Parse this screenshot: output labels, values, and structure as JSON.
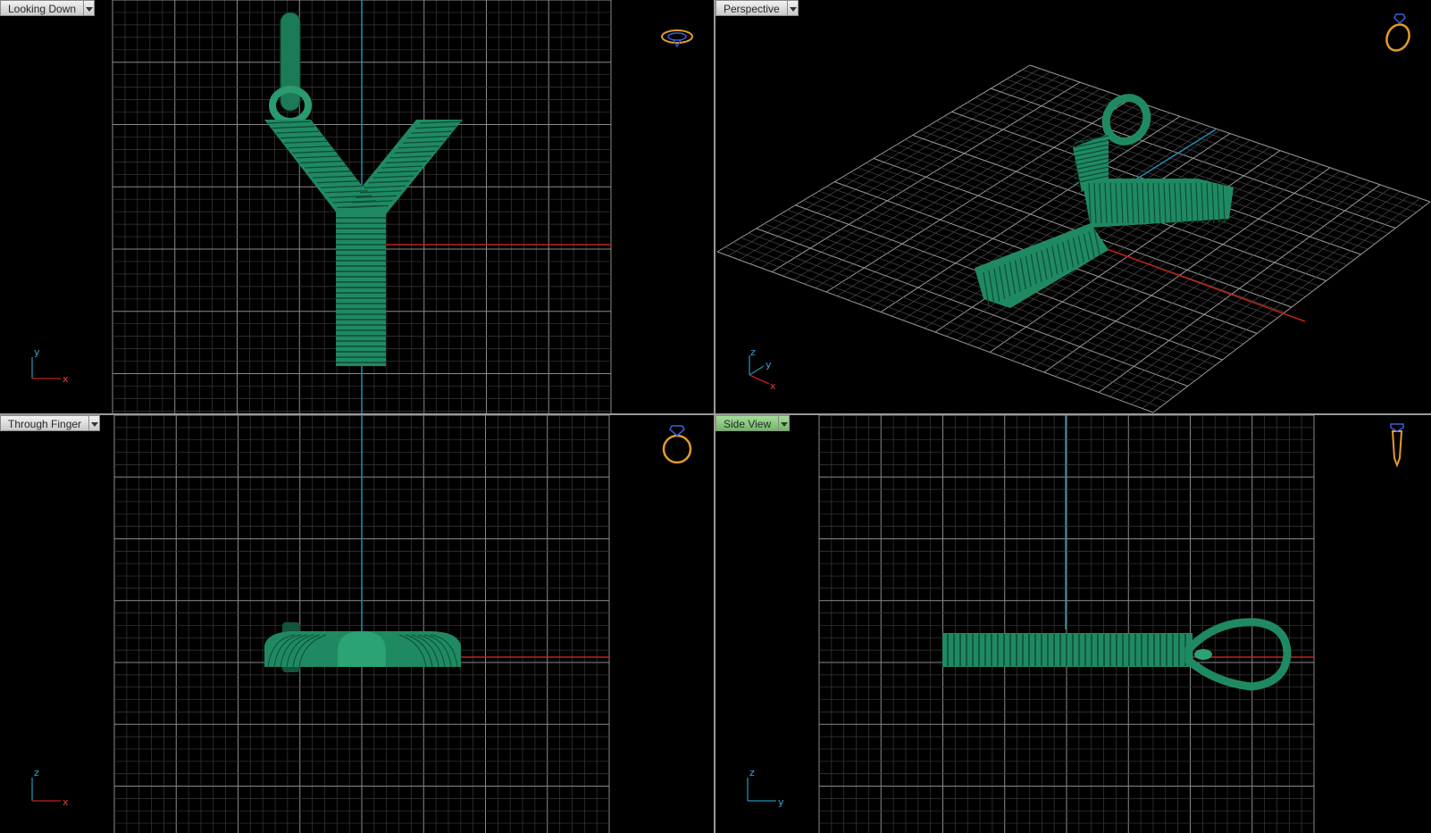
{
  "viewports": {
    "top_left": {
      "label": "Looking Down",
      "active": false,
      "axes": [
        "y",
        "x"
      ]
    },
    "top_right": {
      "label": "Perspective",
      "active": false,
      "axes": [
        "z",
        "y",
        "x"
      ]
    },
    "bottom_left": {
      "label": "Through Finger",
      "active": false,
      "axes": [
        "z",
        "x"
      ]
    },
    "bottom_right": {
      "label": "Side View",
      "active": true,
      "axes": [
        "z",
        "y"
      ]
    }
  },
  "colors": {
    "background": "#000000",
    "grid": "#7a7a7a",
    "model": "#1f8a62",
    "x_axis": "#c0221a",
    "y_axis": "#1f8fb0",
    "z_axis": "#1f8fb0",
    "ring_icon": "#e39a2a",
    "gem_icon": "#3a5fd8"
  },
  "icons": {
    "top_left": "ring-top-view-icon",
    "top_right": "ring-perspective-icon",
    "bottom_left": "ring-front-view-icon",
    "bottom_right": "ring-side-view-icon"
  }
}
